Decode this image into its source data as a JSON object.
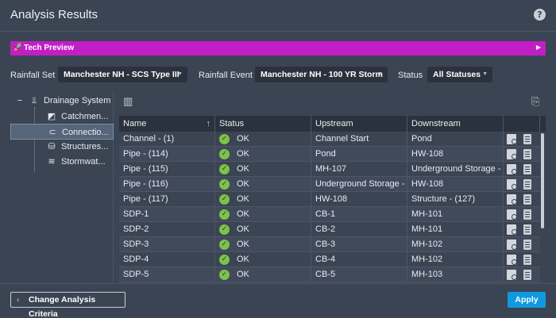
{
  "window": {
    "title": "Analysis Results",
    "help_icon": "?"
  },
  "banner": {
    "label": "Tech Preview",
    "icon": "rocket-icon",
    "color": "#c11fc5"
  },
  "criteria": {
    "rainfall_set_label": "Rainfall Set",
    "rainfall_set_value": "Manchester NH - SCS Type III",
    "rainfall_event_label": "Rainfall Event",
    "rainfall_event_value": "Manchester NH - 100 YR Storm",
    "status_label": "Status",
    "status_value": "All Statuses"
  },
  "tree": {
    "root": "Drainage System",
    "items": [
      "Catchmen...",
      "Connectio...",
      "Structures...",
      "Stormwat..."
    ]
  },
  "table": {
    "columns": [
      "Name",
      "Status",
      "Upstream",
      "Downstream"
    ],
    "rows": [
      {
        "name": "Channel - (1)",
        "status": "OK",
        "upstream": "Channel Start",
        "downstream": "Pond"
      },
      {
        "name": "Pipe - (114)",
        "status": "OK",
        "upstream": "Pond",
        "downstream": "HW-108"
      },
      {
        "name": "Pipe - (115)",
        "status": "OK",
        "upstream": "MH-107",
        "downstream": "Underground Storage -"
      },
      {
        "name": "Pipe - (116)",
        "status": "OK",
        "upstream": "Underground Storage - (1)",
        "downstream": "HW-108"
      },
      {
        "name": "Pipe - (117)",
        "status": "OK",
        "upstream": "HW-108",
        "downstream": "Structure - (127)"
      },
      {
        "name": "SDP-1",
        "status": "OK",
        "upstream": "CB-1",
        "downstream": "MH-101"
      },
      {
        "name": "SDP-2",
        "status": "OK",
        "upstream": "CB-2",
        "downstream": "MH-101"
      },
      {
        "name": "SDP-3",
        "status": "OK",
        "upstream": "CB-3",
        "downstream": "MH-102"
      },
      {
        "name": "SDP-4",
        "status": "OK",
        "upstream": "CB-4",
        "downstream": "MH-102"
      },
      {
        "name": "SDP-5",
        "status": "OK",
        "upstream": "CB-5",
        "downstream": "MH-103"
      }
    ]
  },
  "footer": {
    "back_label": "Change Analysis Criteria",
    "apply_label": "Apply"
  },
  "colors": {
    "ok": "#7cc34a",
    "accent": "#0f9ae0",
    "background": "#3b4453"
  }
}
